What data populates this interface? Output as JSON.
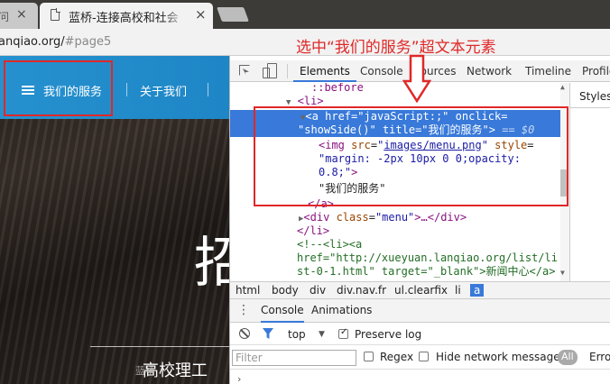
{
  "browser": {
    "prev_tab_title": "问",
    "active_tab_title": "蓝桥-连接高校和社会",
    "url_host": "anqiao.org/",
    "url_path": "#page5"
  },
  "annotation": {
    "text": "选中“我们的服务”超文本元素",
    "color": "#e02828"
  },
  "site": {
    "nav_services": "我们的服务",
    "nav_about": "关于我们",
    "hero_char": "招",
    "hero_text": "高校理工",
    "hero_subtext": "蓝桥"
  },
  "devtools": {
    "tabs": [
      "Elements",
      "Console",
      "Sources",
      "Network",
      "Timeline",
      "Profile"
    ],
    "active_tab": "Elements",
    "styles_label": "Styles",
    "dom": {
      "before": "::before",
      "li_open": "<li>",
      "a_tag": "a",
      "a_href_attr": "href",
      "a_href_val": "\"javaScript:;\"",
      "a_onclick_attr": "onclick",
      "a_onclick_val": "\"showSide()\"",
      "a_title_attr": "title",
      "a_title_val": "\"我们的服务\"",
      "selected_marker": "== $0",
      "img_tag": "img",
      "img_src_attr": "src",
      "img_src_val": "images/menu.png",
      "img_style_attr": "style",
      "img_style_val1": "\"margin: -2px 10px 0 0;opacity:",
      "img_style_val2": "0.8;\"",
      "text_node": "\"我们的服务\"",
      "a_close": "</a>",
      "div_tag": "div",
      "div_class_attr": "class",
      "div_class_val": "\"menu\"",
      "div_rest": ">…</div>",
      "li_close": "</li>",
      "comment1": "<!--<li><a",
      "comment2": "href=\"http://xueyuan.lanqiao.org/list/li",
      "comment3": "st-0-1.html\" target=\"_blank\">新闻中心</a>"
    },
    "breadcrumb": [
      "html",
      "body",
      "div",
      "div.nav.fr",
      "ul.clearfix",
      "li",
      "a"
    ],
    "console": {
      "tabs": [
        "Console",
        "Animations"
      ],
      "context": "top",
      "preserve_log": "Preserve log",
      "filter_placeholder": "Filter",
      "regex": "Regex",
      "hide_network": "Hide network messages",
      "all": "All",
      "errors": "Errors"
    }
  }
}
